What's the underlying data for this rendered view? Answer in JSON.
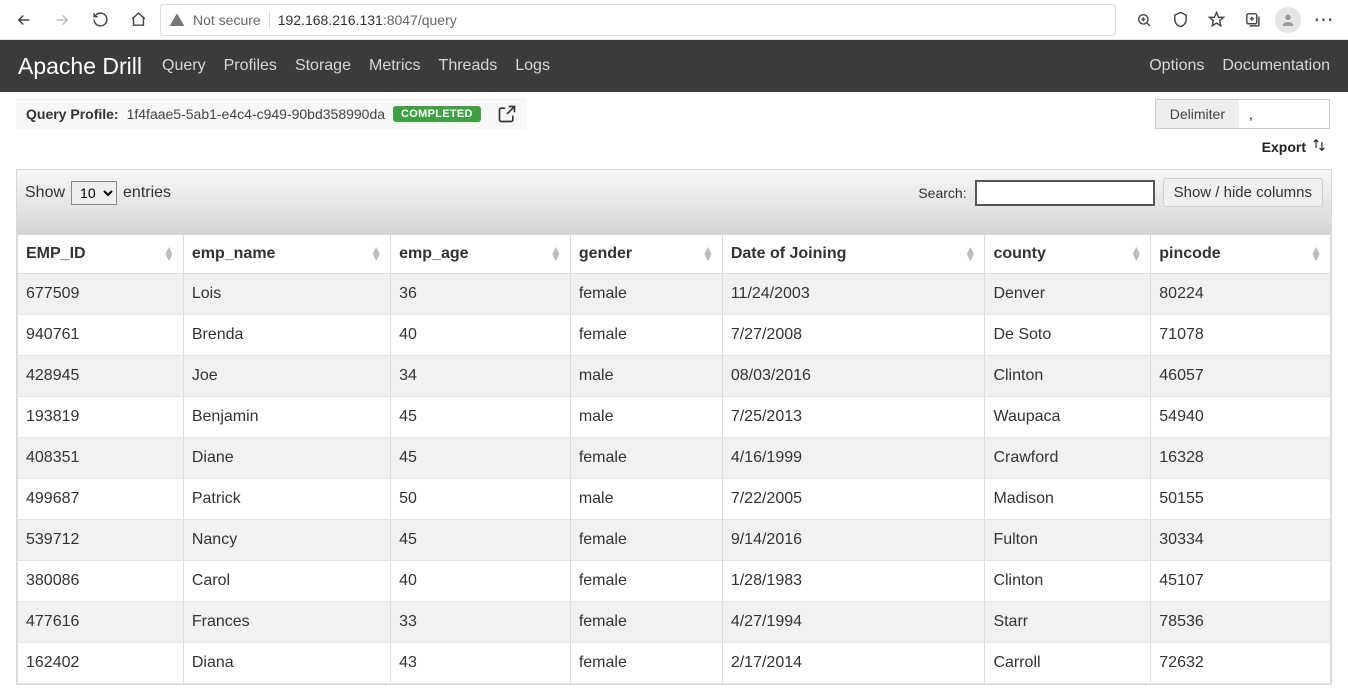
{
  "browser": {
    "not_secure_label": "Not secure",
    "url_host": "192.168.216.131",
    "url_port_path": ":8047/query"
  },
  "navbar": {
    "brand": "Apache Drill",
    "links": [
      "Query",
      "Profiles",
      "Storage",
      "Metrics",
      "Threads",
      "Logs"
    ],
    "right": [
      "Options",
      "Documentation"
    ]
  },
  "profile": {
    "label": "Query Profile:",
    "id": "1f4faae5-5ab1-e4c4-c949-90bd358990da",
    "status": "COMPLETED"
  },
  "delimiter": {
    "label": "Delimiter",
    "value": ","
  },
  "export": {
    "label": "Export"
  },
  "table": {
    "show_pre": "Show",
    "show_post": "entries",
    "page_size": "10",
    "search_label": "Search:",
    "search_value": "",
    "showhide_label": "Show / hide columns",
    "columns": [
      "EMP_ID",
      "emp_name",
      "emp_age",
      "gender",
      "Date of Joining",
      "county",
      "pincode"
    ],
    "rows": [
      {
        "id": "677509",
        "name": "Lois",
        "age": "36",
        "gender": "female",
        "doj": "11/24/2003",
        "county": "Denver",
        "pin": "80224"
      },
      {
        "id": "940761",
        "name": "Brenda",
        "age": "40",
        "gender": "female",
        "doj": "7/27/2008",
        "county": "De Soto",
        "pin": "71078"
      },
      {
        "id": "428945",
        "name": "Joe",
        "age": "34",
        "gender": "male",
        "doj": "08/03/2016",
        "county": "Clinton",
        "pin": "46057"
      },
      {
        "id": "193819",
        "name": "Benjamin",
        "age": "45",
        "gender": "male",
        "doj": "7/25/2013",
        "county": "Waupaca",
        "pin": "54940"
      },
      {
        "id": "408351",
        "name": "Diane",
        "age": "45",
        "gender": "female",
        "doj": "4/16/1999",
        "county": "Crawford",
        "pin": "16328"
      },
      {
        "id": "499687",
        "name": "Patrick",
        "age": "50",
        "gender": "male",
        "doj": "7/22/2005",
        "county": "Madison",
        "pin": "50155"
      },
      {
        "id": "539712",
        "name": "Nancy",
        "age": "45",
        "gender": "female",
        "doj": "9/14/2016",
        "county": "Fulton",
        "pin": "30334"
      },
      {
        "id": "380086",
        "name": "Carol",
        "age": "40",
        "gender": "female",
        "doj": "1/28/1983",
        "county": "Clinton",
        "pin": "45107"
      },
      {
        "id": "477616",
        "name": "Frances",
        "age": "33",
        "gender": "female",
        "doj": "4/27/1994",
        "county": "Starr",
        "pin": "78536"
      },
      {
        "id": "162402",
        "name": "Diana",
        "age": "43",
        "gender": "female",
        "doj": "2/17/2014",
        "county": "Carroll",
        "pin": "72632"
      }
    ]
  }
}
